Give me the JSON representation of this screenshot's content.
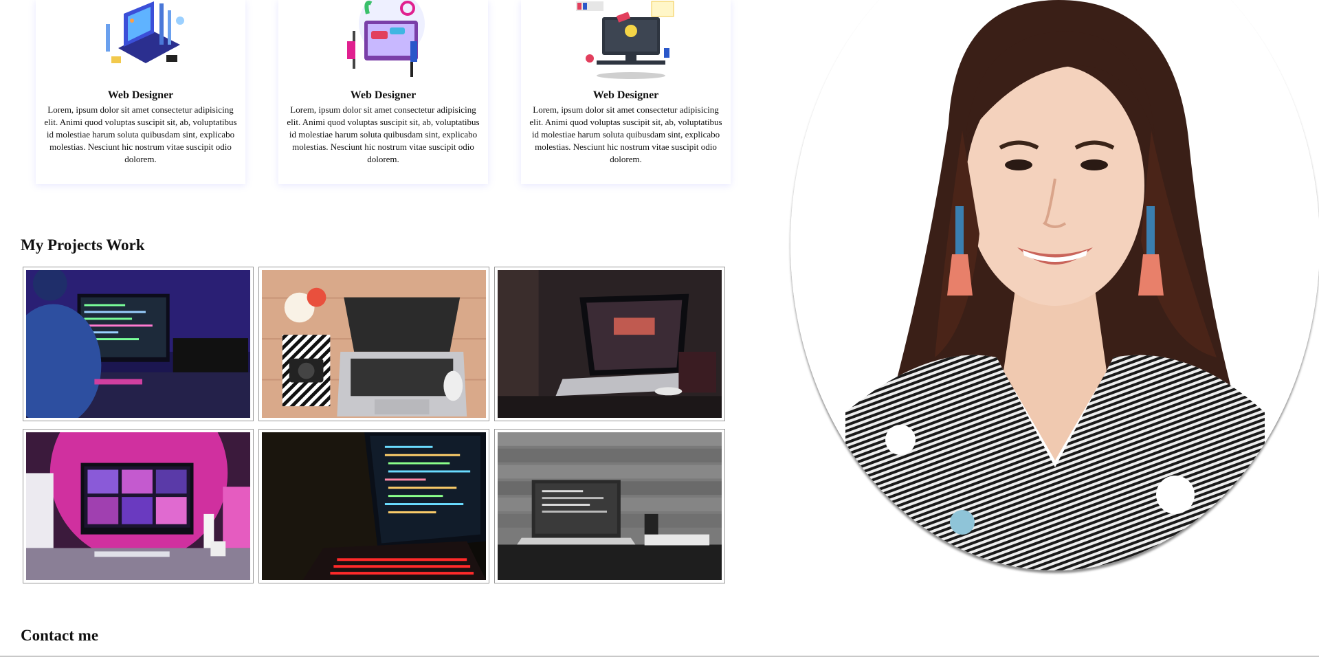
{
  "services": [
    {
      "title": "Web Designer",
      "description": "Lorem, ipsum dolor sit amet consectetur adipisicing elit. Animi quod voluptas suscipit sit, ab, voluptatibus id molestiae harum soluta quibusdam sint, explicabo molestias. Nesciunt hic nostrum vitae suscipit odio dolorem.",
      "icon": "laptop-isometric-illustration"
    },
    {
      "title": "Web Designer",
      "description": "Lorem, ipsum dolor sit amet consectetur adipisicing elit. Animi quod voluptas suscipit sit, ab, voluptatibus id molestiae harum soluta quibusdam sint, explicabo molestias. Nesciunt hic nostrum vitae suscipit odio dolorem.",
      "icon": "web-chat-illustration"
    },
    {
      "title": "Web Designer",
      "description": "Lorem, ipsum dolor sit amet consectetur adipisicing elit. Animi quod voluptas suscipit sit, ab, voluptatibus id molestiae harum soluta quibusdam sint, explicabo molestias. Nesciunt hic nostrum vitae suscipit odio dolorem.",
      "icon": "monitor-lightbulb-illustration"
    }
  ],
  "projects": {
    "heading": "My Projects Work",
    "items": [
      {
        "name": "project-coder-neon-desk"
      },
      {
        "name": "project-laptop-camera-flatlay"
      },
      {
        "name": "project-dark-laptop-desk"
      },
      {
        "name": "project-pink-imac-setup"
      },
      {
        "name": "project-code-laptop-red-keys"
      },
      {
        "name": "project-bw-laptop-brick-wall"
      }
    ]
  },
  "contact": {
    "heading": "Contact me"
  },
  "colors": {
    "card_shadow": "#7878ff",
    "thumb_border": "#999999",
    "accent_pink": "#e0208f",
    "accent_blue": "#2a57c9"
  }
}
